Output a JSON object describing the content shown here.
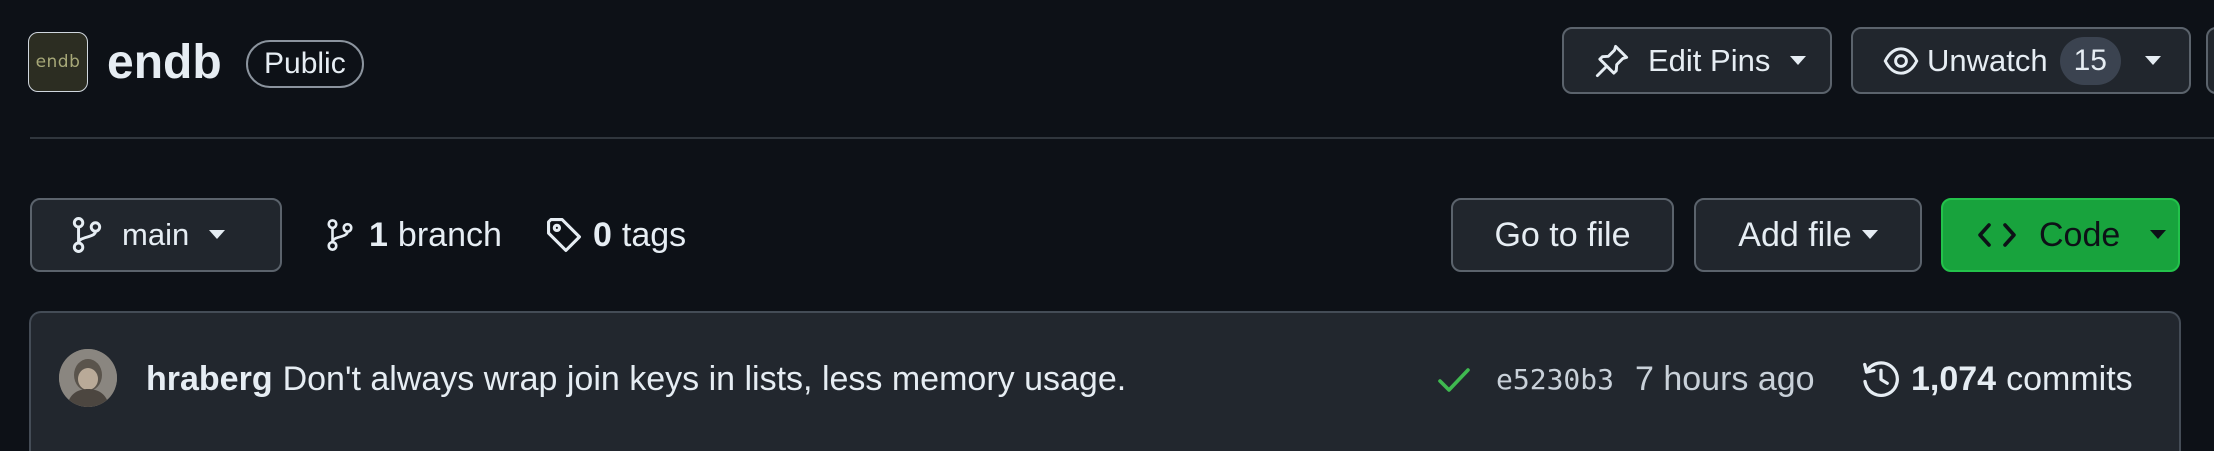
{
  "repo": {
    "avatar_text": "endb",
    "name": "endb",
    "visibility": "Public"
  },
  "header_actions": {
    "edit_pins_label": "Edit Pins",
    "unwatch_label": "Unwatch",
    "watch_count": "15"
  },
  "toolbar": {
    "branch_name": "main",
    "branch_count": "1",
    "branch_label": "branch",
    "tag_count": "0",
    "tag_label": "tags",
    "goto_file_label": "Go to file",
    "add_file_label": "Add file",
    "code_label": "Code"
  },
  "latest_commit": {
    "author": "hraberg",
    "message": "Don't always wrap join keys in lists, less memory usage.",
    "status": "success",
    "hash": "e5230b3",
    "time": "7 hours ago",
    "commit_count": "1,074",
    "commits_label": "commits"
  },
  "colors": {
    "background": "#0d1117",
    "button": "#21262d",
    "code_button": "#18a33d",
    "check": "#3fb950"
  },
  "icons": {
    "pin": "pin-icon",
    "eye": "eye-icon",
    "branch": "git-branch-icon",
    "tag": "tag-icon",
    "code": "code-icon",
    "check": "check-icon",
    "history": "history-icon",
    "caret": "caret-down-icon"
  }
}
